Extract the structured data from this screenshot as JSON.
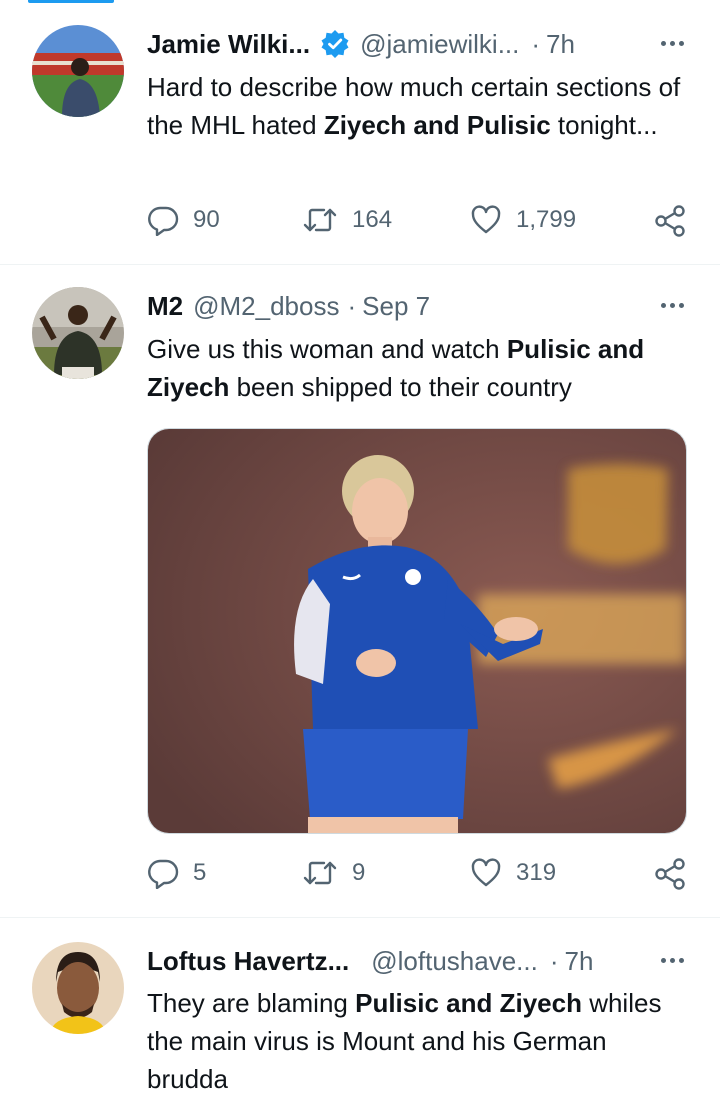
{
  "tweets": [
    {
      "author": "Jamie Wilki...",
      "verified": true,
      "handle": "@jamiewilki...",
      "time": "7h",
      "text": [
        {
          "t": "Hard to describe how much certain sections of the MHL hated ",
          "b": false
        },
        {
          "t": "Ziyech and Pulisic",
          "b": true
        },
        {
          "t": " tonight...",
          "b": false
        }
      ],
      "replies": "90",
      "retweets": "164",
      "likes": "1,799"
    },
    {
      "author": "M2",
      "verified": false,
      "handle": "@M2_dboss",
      "time": "Sep 7",
      "text": [
        {
          "t": "Give us this woman and watch ",
          "b": false
        },
        {
          "t": "Pulisic and Ziyech",
          "b": true
        },
        {
          "t": " been shipped to their country",
          "b": false
        }
      ],
      "has_media": true,
      "replies": "5",
      "retweets": "9",
      "likes": "319"
    },
    {
      "author": "Loftus Havertz...",
      "verified": false,
      "handle": "@loftushave...",
      "time": "7h",
      "text": [
        {
          "t": "They are blaming ",
          "b": false
        },
        {
          "t": "Pulisic and Ziyech",
          "b": true
        },
        {
          "t": " whiles the main virus is Mount and his German brudda",
          "b": false
        }
      ]
    }
  ],
  "separator": "·",
  "icons": {
    "reply": "reply-icon",
    "retweet": "retweet-icon",
    "like": "like-icon",
    "share": "share-icon",
    "more": "more-icon",
    "verified": "verified-badge-icon"
  },
  "colors": {
    "accent": "#1d9bf0",
    "secondary_text": "#536471",
    "divider": "#eff3f4"
  }
}
